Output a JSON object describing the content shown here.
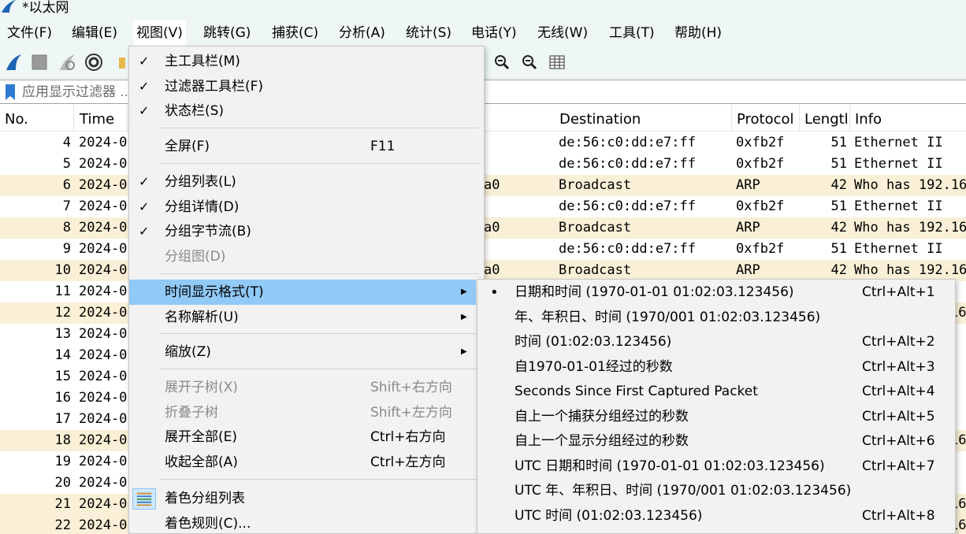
{
  "window": {
    "title": "*以太网"
  },
  "menubar": [
    {
      "label": "文件(F)"
    },
    {
      "label": "编辑(E)"
    },
    {
      "label": "视图(V)"
    },
    {
      "label": "跳转(G)"
    },
    {
      "label": "捕获(C)"
    },
    {
      "label": "分析(A)"
    },
    {
      "label": "统计(S)"
    },
    {
      "label": "电话(Y)"
    },
    {
      "label": "无线(W)"
    },
    {
      "label": "工具(T)"
    },
    {
      "label": "帮助(H)"
    }
  ],
  "toolbar": {
    "icons": [
      "start-capture-icon",
      "stop-capture-icon",
      "restart-capture-icon",
      "capture-options-icon",
      "open-file-icon",
      "zoom-in-icon",
      "zoom-out-icon",
      "resize-columns-icon"
    ]
  },
  "filter": {
    "placeholder": "应用显示过滤器 … <Ctrl-/>"
  },
  "packet_list": {
    "columns": [
      "No.",
      "Time",
      "Destination",
      "Protocol",
      "Lengtl",
      "Info"
    ],
    "rows": [
      {
        "no": "4",
        "time": "2024-0",
        "source_tail": "",
        "dst": "de:56:c0:dd:e7:ff",
        "proto": "0xfb2f",
        "len": "51",
        "info": "Ethernet II",
        "arp": false
      },
      {
        "no": "5",
        "time": "2024-0",
        "source_tail": "",
        "dst": "de:56:c0:dd:e7:ff",
        "proto": "0xfb2f",
        "len": "51",
        "info": "Ethernet II",
        "arp": false
      },
      {
        "no": "6",
        "time": "2024-0",
        "source_tail": "a0",
        "dst": "Broadcast",
        "proto": "ARP",
        "len": "42",
        "info": "Who has 192.16",
        "arp": true
      },
      {
        "no": "7",
        "time": "2024-0",
        "source_tail": "",
        "dst": "de:56:c0:dd:e7:ff",
        "proto": "0xfb2f",
        "len": "51",
        "info": "Ethernet II",
        "arp": false
      },
      {
        "no": "8",
        "time": "2024-0",
        "source_tail": "a0",
        "dst": "Broadcast",
        "proto": "ARP",
        "len": "42",
        "info": "Who has 192.16",
        "arp": true
      },
      {
        "no": "9",
        "time": "2024-0",
        "source_tail": "",
        "dst": "de:56:c0:dd:e7:ff",
        "proto": "0xfb2f",
        "len": "51",
        "info": "Ethernet II",
        "arp": false
      },
      {
        "no": "10",
        "time": "2024-0",
        "source_tail": "a0",
        "dst": "Broadcast",
        "proto": "ARP",
        "len": "42",
        "info": "Who has 192.16",
        "arp": true
      },
      {
        "no": "11",
        "time": "2024-0",
        "source_tail": "",
        "dst": "",
        "proto": "",
        "len": "",
        "info": "",
        "arp": false
      },
      {
        "no": "12",
        "time": "2024-0",
        "source_tail": "",
        "dst": "",
        "proto": "",
        "len": "",
        "info": "16",
        "arp": true
      },
      {
        "no": "13",
        "time": "2024-0",
        "source_tail": "",
        "dst": "",
        "proto": "",
        "len": "",
        "info": "",
        "arp": false
      },
      {
        "no": "14",
        "time": "2024-0",
        "source_tail": "",
        "dst": "",
        "proto": "",
        "len": "",
        "info": "",
        "arp": false
      },
      {
        "no": "15",
        "time": "2024-0",
        "source_tail": "",
        "dst": "",
        "proto": "",
        "len": "",
        "info": "",
        "arp": false
      },
      {
        "no": "16",
        "time": "2024-0",
        "source_tail": "",
        "dst": "",
        "proto": "",
        "len": "",
        "info": "",
        "arp": false
      },
      {
        "no": "17",
        "time": "2024-0",
        "source_tail": "",
        "dst": "",
        "proto": "",
        "len": "",
        "info": "",
        "arp": false
      },
      {
        "no": "18",
        "time": "2024-0",
        "source_tail": "",
        "dst": "",
        "proto": "",
        "len": "",
        "info": "16",
        "arp": true
      },
      {
        "no": "19",
        "time": "2024-0",
        "source_tail": "",
        "dst": "",
        "proto": "",
        "len": "",
        "info": "",
        "arp": false
      },
      {
        "no": "20",
        "time": "2024-0",
        "source_tail": "",
        "dst": "",
        "proto": "",
        "len": "",
        "info": "",
        "arp": false
      },
      {
        "no": "21",
        "time": "2024-0",
        "source_tail": "",
        "dst": "",
        "proto": "",
        "len": "",
        "info": "16",
        "arp": true
      },
      {
        "no": "22",
        "time": "2024-0",
        "source_tail": "",
        "dst": "",
        "proto": "",
        "len": "",
        "info": "16",
        "arp": true
      }
    ]
  },
  "view_menu": {
    "items": [
      {
        "label": "主工具栏(M)",
        "shortcut": "",
        "check": "✓",
        "disabled": false
      },
      {
        "label": "过滤器工具栏(F)",
        "shortcut": "",
        "check": "✓",
        "disabled": false
      },
      {
        "label": "状态栏(S)",
        "shortcut": "",
        "check": "✓",
        "disabled": false
      },
      {
        "label": "全屏(F)",
        "shortcut": "F11",
        "check": "",
        "disabled": false
      },
      {
        "label": "分组列表(L)",
        "shortcut": "",
        "check": "✓",
        "disabled": false
      },
      {
        "label": "分组详情(D)",
        "shortcut": "",
        "check": "✓",
        "disabled": false
      },
      {
        "label": "分组字节流(B)",
        "shortcut": "",
        "check": "✓",
        "disabled": false
      },
      {
        "label": "分组图(D)",
        "shortcut": "",
        "check": "",
        "disabled": true
      },
      {
        "label": "时间显示格式(T)",
        "shortcut": "",
        "check": "",
        "disabled": false,
        "submenu": true,
        "highlighted": true
      },
      {
        "label": "名称解析(U)",
        "shortcut": "",
        "check": "",
        "disabled": false,
        "submenu": true
      },
      {
        "label": "缩放(Z)",
        "shortcut": "",
        "check": "",
        "disabled": false,
        "submenu": true
      },
      {
        "label": "展开子树(X)",
        "shortcut": "Shift+右方向",
        "check": "",
        "disabled": true
      },
      {
        "label": "折叠子树",
        "shortcut": "Shift+左方向",
        "check": "",
        "disabled": true
      },
      {
        "label": "展开全部(E)",
        "shortcut": "Ctrl+右方向",
        "check": "",
        "disabled": false
      },
      {
        "label": "收起全部(A)",
        "shortcut": "Ctrl+左方向",
        "check": "",
        "disabled": false
      },
      {
        "label": "着色分组列表",
        "shortcut": "",
        "check": "",
        "disabled": false,
        "icon": "colorize-list-icon"
      },
      {
        "label": "着色规则(C)...",
        "shortcut": "",
        "check": "",
        "disabled": false
      }
    ]
  },
  "time_format_menu": {
    "items": [
      {
        "label": "日期和时间 (1970-01-01 01:02:03.123456)",
        "shortcut": "Ctrl+Alt+1",
        "selected": true
      },
      {
        "label": "年、年积日、时间 (1970/001 01:02:03.123456)",
        "shortcut": "",
        "selected": false
      },
      {
        "label": "时间 (01:02:03.123456)",
        "shortcut": "Ctrl+Alt+2",
        "selected": false
      },
      {
        "label": "自1970-01-01经过的秒数",
        "shortcut": "Ctrl+Alt+3",
        "selected": false
      },
      {
        "label": "Seconds Since First Captured Packet",
        "shortcut": "Ctrl+Alt+4",
        "selected": false
      },
      {
        "label": "自上一个捕获分组经过的秒数",
        "shortcut": "Ctrl+Alt+5",
        "selected": false
      },
      {
        "label": "自上一个显示分组经过的秒数",
        "shortcut": "Ctrl+Alt+6",
        "selected": false
      },
      {
        "label": "UTC 日期和时间 (1970-01-01 01:02:03.123456)",
        "shortcut": "Ctrl+Alt+7",
        "selected": false
      },
      {
        "label": "UTC 年、年积日、时间 (1970/001 01:02:03.123456)",
        "shortcut": "",
        "selected": false
      },
      {
        "label": "UTC 时间 (01:02:03.123456)",
        "shortcut": "Ctrl+Alt+8",
        "selected": false
      }
    ],
    "bullet": "•"
  },
  "colors": {
    "chrome_bg": "#eef7f6",
    "menu_bg": "#f2f2f2",
    "highlight": "#91c9f7",
    "arp_row": "#faf0d7",
    "wireshark_blue": "#1c64b4"
  }
}
